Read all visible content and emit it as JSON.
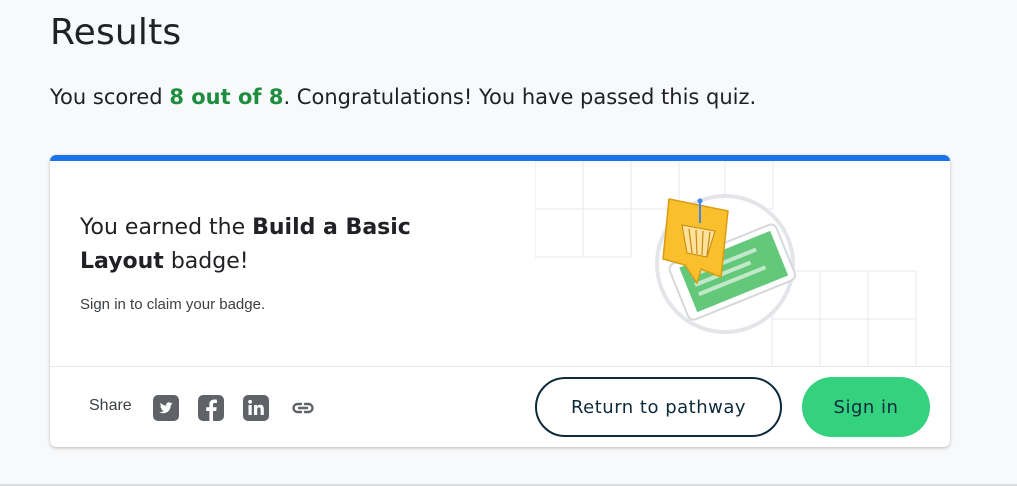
{
  "page": {
    "title": "Results"
  },
  "score": {
    "prefix": "You scored ",
    "value": "8 out of 8",
    "suffix": ". Congratulations! You have passed this quiz.",
    "color": "#1e8e3e"
  },
  "card": {
    "accent_color": "#1a73e8",
    "badge": {
      "prefix": "You earned the ",
      "name": "Build a Basic Layout",
      "suffix": " badge!"
    },
    "claim_text": "Sign in to claim your badge.",
    "illustration": "badge-illustration"
  },
  "footer": {
    "share_label": "Share",
    "share_icons": [
      "twitter-icon",
      "facebook-icon",
      "linkedin-icon",
      "link-icon"
    ],
    "return_button": "Return to pathway",
    "signin_button": "Sign in",
    "signin_color": "#34d17e"
  }
}
